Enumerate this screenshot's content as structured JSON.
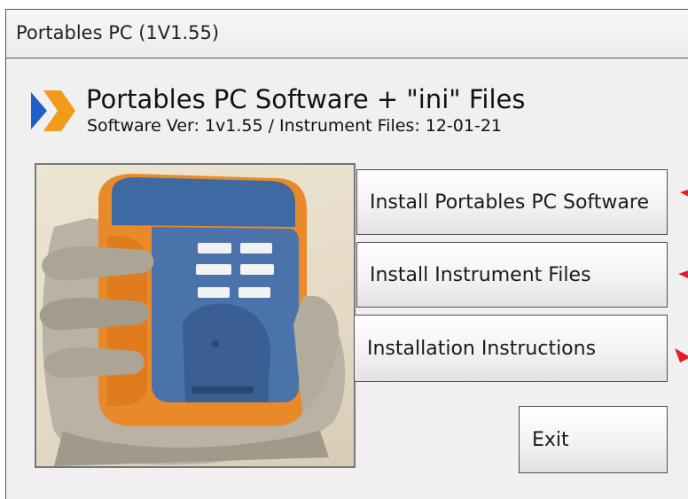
{
  "window": {
    "title": "Portables PC (1V1.55)"
  },
  "app": {
    "heading": "Portables PC Software + \"ini\" Files",
    "subheading": "Software Ver: 1v1.55 / Instrument Files: 12-01-21"
  },
  "buttons": {
    "install_software": "Install Portables PC Software",
    "install_files": "Install Instrument Files",
    "instructions": "Installation Instructions",
    "exit": "Exit"
  },
  "colors": {
    "logo_blue": "#1f5fc8",
    "logo_orange": "#f39a1b",
    "annotation_red": "#e31e24",
    "device_blue": "#3e6aa3",
    "device_orange": "#e98a2a"
  },
  "icons": {
    "logo": "chevron-logo-icon",
    "annotation": "red-arrow-icon"
  }
}
